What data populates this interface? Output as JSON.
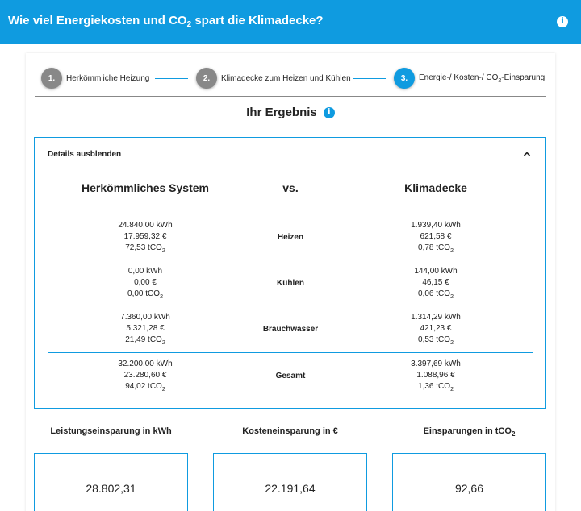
{
  "header": {
    "title_pre": "Wie viel Energiekosten und CO",
    "title_sub": "2",
    "title_post": " spart die Klimadecke?",
    "info_icon": "i"
  },
  "steps": [
    {
      "number": "1.",
      "label": "Herkömmliche Heizung",
      "active": false
    },
    {
      "number": "2.",
      "label": "Klimadecke zum Heizen und Kühlen",
      "active": false
    },
    {
      "number": "3.",
      "label_pre": "Energie-/ Kosten-/ CO",
      "label_sub": "2",
      "label_post": "-Einsparung",
      "active": true
    }
  ],
  "result": {
    "title": "Ihr Ergebnis",
    "info_icon": "i"
  },
  "details": {
    "toggle_label": "Details ausblenden",
    "left_heading": "Herkömmliches System",
    "vs_label": "vs.",
    "right_heading": "Klimadecke",
    "rows": [
      {
        "label": "Heizen",
        "left": {
          "kwh": "24.840,00 kWh",
          "eur": "17.959,32 €",
          "co2": "72,53 tCO"
        },
        "right": {
          "kwh": "1.939,40 kWh",
          "eur": "621,58 €",
          "co2": "0,78 tCO"
        }
      },
      {
        "label": "Kühlen",
        "left": {
          "kwh": "0,00 kWh",
          "eur": "0,00 €",
          "co2": "0,00 tCO"
        },
        "right": {
          "kwh": "144,00 kWh",
          "eur": "46,15 €",
          "co2": "0,06 tCO"
        }
      },
      {
        "label": "Brauchwasser",
        "left": {
          "kwh": "7.360,00 kWh",
          "eur": "5.321,28 €",
          "co2": "21,49 tCO"
        },
        "right": {
          "kwh": "1.314,29 kWh",
          "eur": "421,23 €",
          "co2": "0,53 tCO"
        }
      },
      {
        "label": "Gesamt",
        "left": {
          "kwh": "32.200,00 kWh",
          "eur": "23.280,60 €",
          "co2": "94,02 tCO"
        },
        "right": {
          "kwh": "3.397,69 kWh",
          "eur": "1.088,96 €",
          "co2": "1,36 tCO"
        }
      }
    ],
    "co2_sub": "2"
  },
  "summary": [
    {
      "label": "Leistungseinsparung in kWh",
      "value": "28.802,31"
    },
    {
      "label": "Kosteneinsparung in €",
      "value": "22.191,64"
    },
    {
      "label_pre": "Einsparungen in tCO",
      "label_sub": "2",
      "value": "92,66"
    }
  ],
  "colors": {
    "accent": "#0f9be0",
    "inactive_step": "#888888"
  }
}
